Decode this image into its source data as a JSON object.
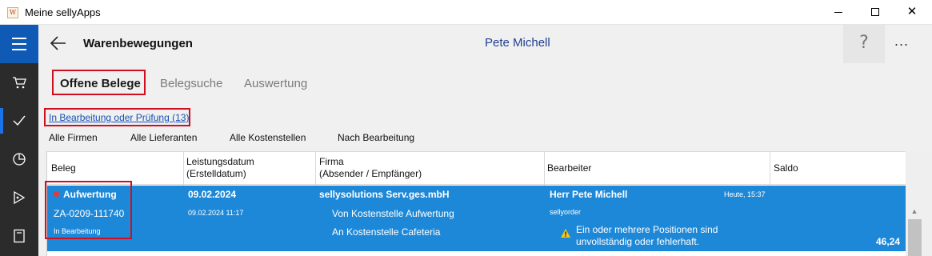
{
  "window": {
    "title": "Meine sellyApps",
    "app_icon_glyph": "W",
    "minimize_label": "",
    "maximize_label": "",
    "close_label": "✕"
  },
  "rail": {
    "items": [
      {
        "icon": "menu-icon"
      },
      {
        "icon": "cart-icon"
      },
      {
        "icon": "check-icon",
        "active": true
      },
      {
        "icon": "pie-chart-icon"
      },
      {
        "icon": "tag-icon"
      },
      {
        "icon": "book-icon"
      }
    ],
    "accent": "#0f5ab5"
  },
  "header": {
    "title": "Warenbewegungen",
    "user": "Pete Michell",
    "help": "?",
    "more": "..."
  },
  "tabs": [
    {
      "label": "Offene Belege",
      "active": true
    },
    {
      "label": "Belegsuche",
      "active": false
    },
    {
      "label": "Auswertung",
      "active": false
    }
  ],
  "filter": {
    "link": "In Bearbeitung oder Prüfung (13)",
    "buttons": [
      "Alle Firmen",
      "Alle Lieferanten",
      "Alle Kostenstellen",
      "Nach Bearbeitung"
    ]
  },
  "table": {
    "columns": [
      {
        "line1": "Beleg",
        "line2": ""
      },
      {
        "line1": "Leistungsdatum",
        "line2": "(Erstelldatum)"
      },
      {
        "line1": "Firma",
        "line2": "(Absender / Empfänger)"
      },
      {
        "line1": "Bearbeiter",
        "line2": ""
      },
      {
        "line1": "Saldo",
        "line2": ""
      }
    ],
    "rows": [
      {
        "beleg_type": "Aufwertung",
        "beleg_number": "ZA-0209-111740",
        "beleg_status": "In Bearbeitung",
        "leistungsdatum": "09.02.2024",
        "erstelldatum": "09.02.2024 11:17",
        "firma": "sellysolutions Serv.ges.mbH",
        "von": "Von Kostenstelle  Aufwertung",
        "an": "An Kostenstelle  Cafeteria",
        "bearbeiter": "Herr Pete Michell",
        "bearbeiter_time": "Heute, 15:37",
        "bearbeiter_sub": "sellyorder",
        "warning_line1": "Ein oder mehrere Positionen sind",
        "warning_line2": "unvollständig oder fehlerhaft.",
        "saldo": "46,24"
      }
    ],
    "selected_color": "#1e88d8",
    "status_dot_color": "#e53935"
  }
}
